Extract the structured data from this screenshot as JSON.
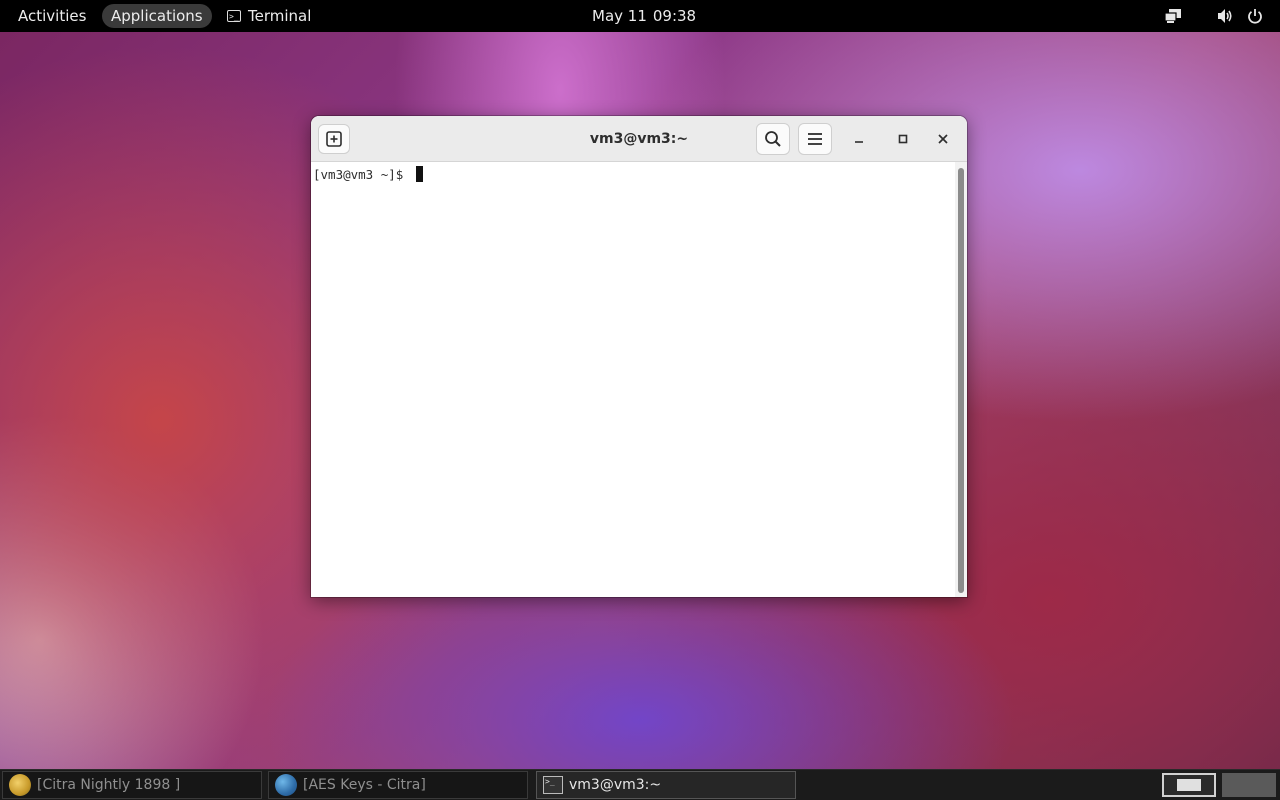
{
  "topbar": {
    "activities": "Activities",
    "applications": "Applications",
    "app_name": "Terminal",
    "date": "May 11",
    "time": "09:38",
    "tray": [
      "network-icon",
      "volume-icon",
      "power-icon"
    ]
  },
  "terminal": {
    "title": "vm3@vm3:~",
    "prompt": "[vm3@vm3 ~]$ ",
    "header_buttons": [
      "new-tab-icon",
      "search-icon",
      "hamburger-menu-icon",
      "minimize-icon",
      "maximize-icon",
      "close-icon"
    ]
  },
  "taskbar": {
    "items": [
      {
        "label": "[Citra Nightly 1898 ]",
        "icon": "citra-icon",
        "active": false
      },
      {
        "label": "[AES Keys - Citra]",
        "icon": "globe-icon",
        "active": false
      },
      {
        "label": "vm3@vm3:~",
        "icon": "terminal-icon",
        "active": true
      }
    ],
    "workspaces": 2,
    "active_workspace": 1
  },
  "colors": {
    "topbar_bg": "#000000",
    "titlebar_bg": "#ebebeb",
    "terminal_bg": "#ffffff",
    "taskbar_bg": "#1b1b1b"
  }
}
